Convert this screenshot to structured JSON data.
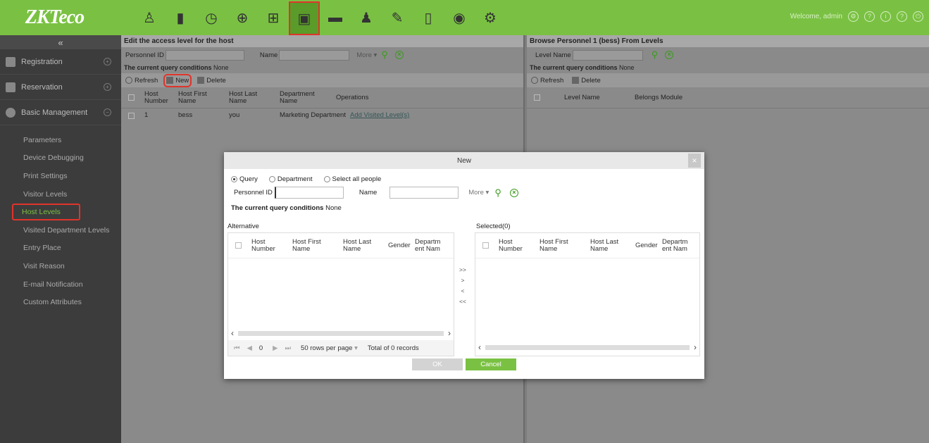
{
  "header": {
    "logo": "ZKTeco",
    "welcome": "Welcome, admin",
    "modules": [
      "registration-module",
      "access-module",
      "time-module",
      "elevator-module",
      "entrance-module",
      "visitor-module",
      "parking-module",
      "patrol-module",
      "office-module",
      "guard-module",
      "video-module",
      "system-module"
    ],
    "active_module_index": 5
  },
  "sidebar": {
    "sections": [
      {
        "label": "Registration",
        "toggle": "+"
      },
      {
        "label": "Reservation",
        "toggle": "+"
      },
      {
        "label": "Basic Management",
        "toggle": "−"
      }
    ],
    "items": [
      {
        "label": "Parameters"
      },
      {
        "label": "Device Debugging"
      },
      {
        "label": "Print Settings"
      },
      {
        "label": "Visitor Levels"
      },
      {
        "label": "Host Levels"
      },
      {
        "label": "Visited Department Levels"
      },
      {
        "label": "Entry Place"
      },
      {
        "label": "Visit Reason"
      },
      {
        "label": "E-mail Notification"
      },
      {
        "label": "Custom Attributes"
      }
    ],
    "active_item": "Host Levels"
  },
  "left_pane": {
    "title": "Edit the access level for the host",
    "personnel_id_label": "Personnel ID",
    "name_label": "Name",
    "more_label": "More",
    "cond_label": "The current query conditions",
    "cond_value": "None",
    "toolbar": {
      "refresh": "Refresh",
      "new": "New",
      "delete": "Delete"
    },
    "columns": [
      "Host Number",
      "Host First Name",
      "Host Last Name",
      "Department Name",
      "Operations"
    ],
    "rows": [
      {
        "number": "1",
        "first": "bess",
        "last": "you",
        "dept": "Marketing Department",
        "op": "Add Visited Level(s)"
      }
    ]
  },
  "right_pane": {
    "title": "Browse Personnel 1  (bess)  From Levels",
    "level_name_label": "Level Name",
    "cond_label": "The current query conditions",
    "cond_value": "None",
    "toolbar": {
      "refresh": "Refresh",
      "delete": "Delete"
    },
    "columns": [
      "Level Name",
      "Belongs Module"
    ]
  },
  "modal": {
    "title": "New",
    "close": "×",
    "radios": [
      "Query",
      "Department",
      "Select all people"
    ],
    "selected_radio": "Query",
    "personnel_id_label": "Personnel ID",
    "name_label": "Name",
    "more_label": "More",
    "cond_label": "The current query conditions",
    "cond_value": "None",
    "alternative_label": "Alternative",
    "selected_label": "Selected(0)",
    "alt_columns": [
      "Host Number",
      "Host First Name",
      "Host Last Name",
      "Gender",
      "Department Name"
    ],
    "sel_columns": [
      "Host Number",
      "Host First Name",
      "Host Last Name",
      "Gender",
      "Department Name"
    ],
    "transfer": [
      ">>",
      ">",
      "<",
      "<<"
    ],
    "pager": {
      "page": "0",
      "per_page": "50 rows per page",
      "total": "Total of 0 records"
    },
    "ok": "OK",
    "cancel": "Cancel"
  },
  "colors": {
    "brand_green": "#7ac143",
    "highlight_red": "#e0342b"
  }
}
